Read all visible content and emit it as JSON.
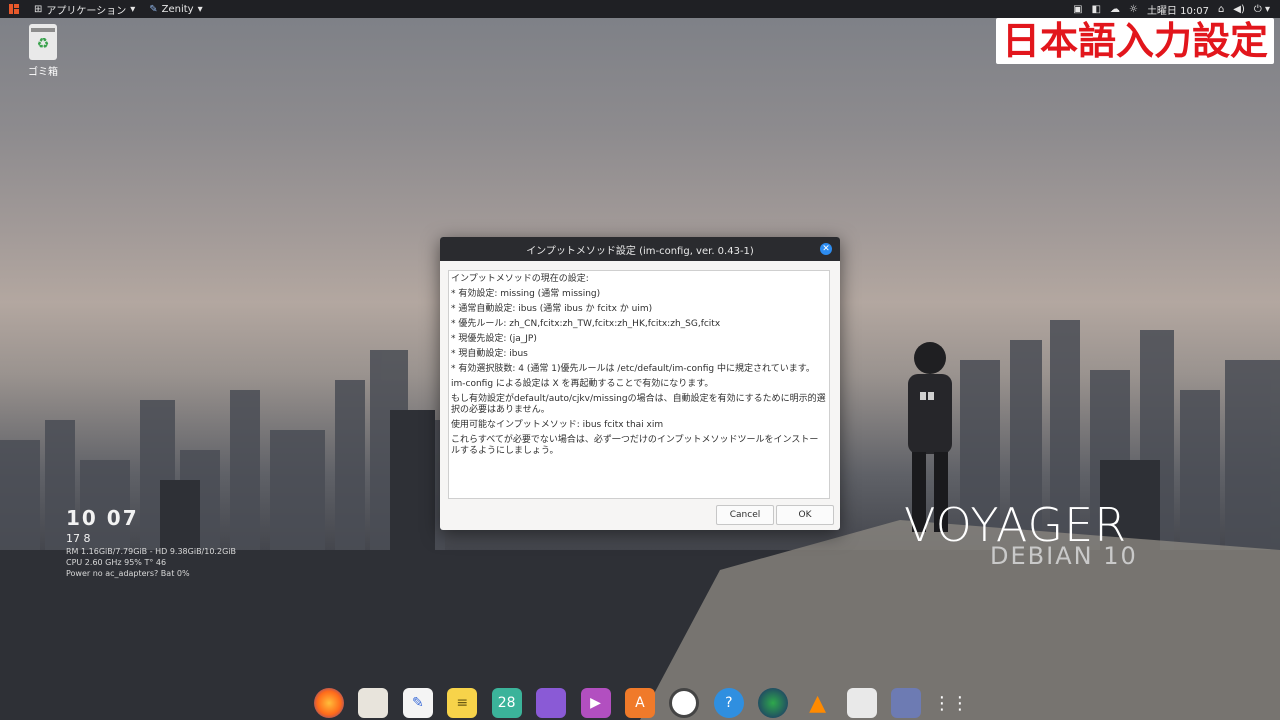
{
  "topbar": {
    "apps_menu": "アプリケーション",
    "window_menu": "Zenity",
    "datetime": "土曜日 10:07"
  },
  "desktop": {
    "trash_label": "ゴミ箱",
    "banner_text": "日本語入力設定",
    "voyager_text": "VOYAGER",
    "debian_text": "DEBIAN 10"
  },
  "conky": {
    "clock": "10 07",
    "date": "17 8",
    "line1": "RM 1.16GiB/7.79GiB - HD 9.38GiB/10.2GiB",
    "line2": "CPU 2.60 GHz 95% T° 46",
    "line3": "Power no ac_adapters? Bat 0%"
  },
  "dialog": {
    "title": "インプットメソッド設定 (im-config, ver. 0.43-1)",
    "lines": [
      "インプットメソッドの現在の設定:",
      " * 有効設定: missing (通常 missing)",
      " * 通常自動設定: ibus (通常 ibus か fcitx か uim)",
      " * 優先ルール: zh_CN,fcitx:zh_TW,fcitx:zh_HK,fcitx:zh_SG,fcitx",
      " * 現優先設定: (ja_JP)",
      " * 現自動設定: ibus",
      " * 有効選択肢数: 4 (通常 1)優先ルールは /etc/default/im-config 中に規定されています。",
      "im-config による設定は X を再起動することで有効になります。",
      "もし有効設定がdefault/auto/cjkv/missingの場合は、自動設定を有効にするために明示的選択の必要はありません。",
      " 使用可能なインプットメソッド: ibus fcitx thai xim",
      "これらすべてが必要でない場合は、必ず一つだけのインプットメソッドツールをインストールするようにしましょう。"
    ],
    "cancel_label": "Cancel",
    "ok_label": "OK"
  },
  "dock": {
    "calendar_day": "28",
    "help_glyph": "?"
  }
}
